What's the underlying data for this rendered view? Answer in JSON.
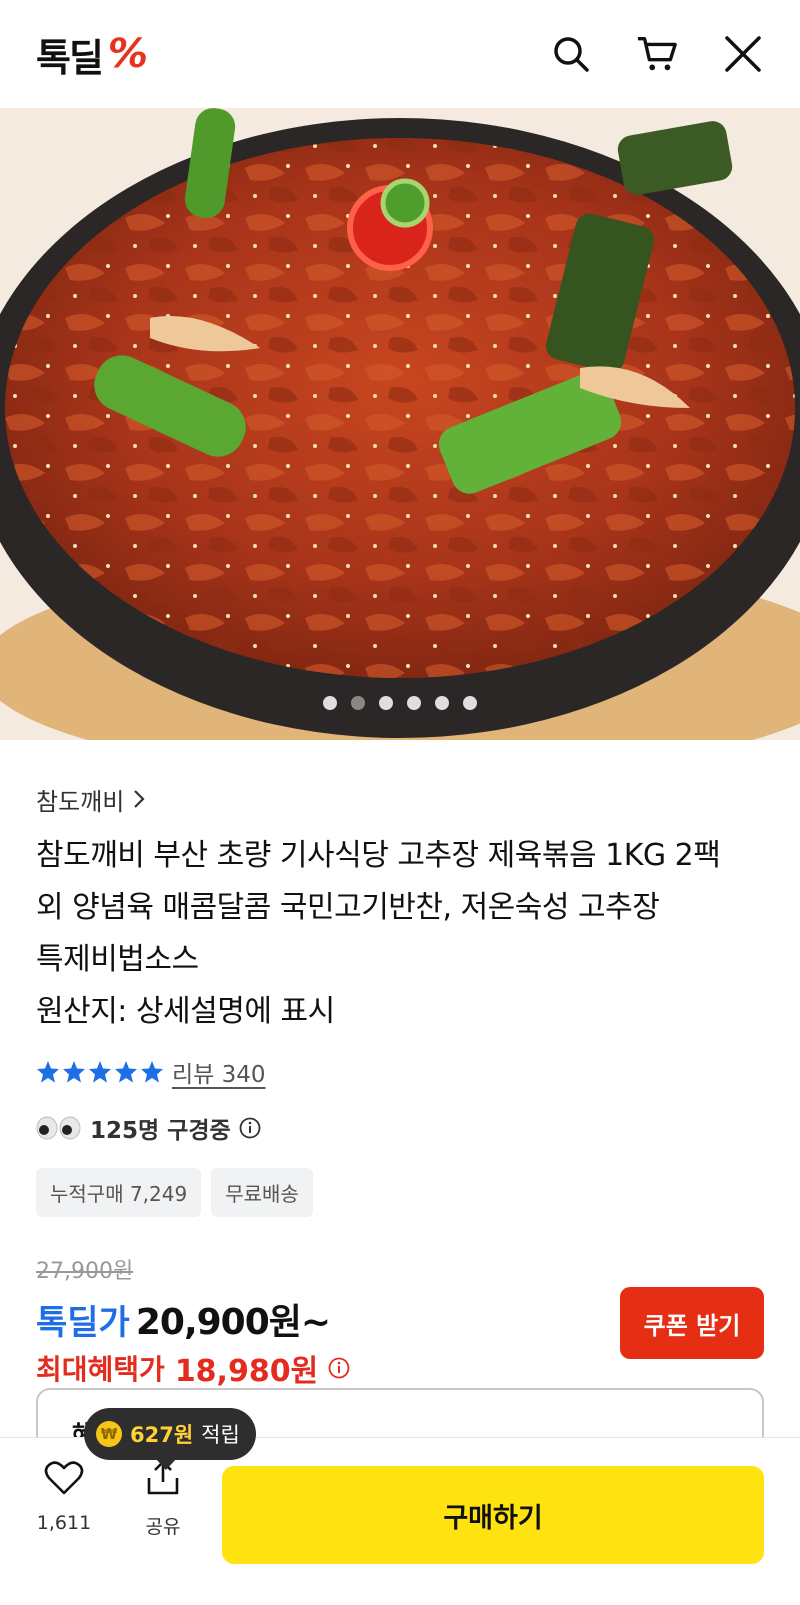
{
  "header": {
    "logo_text": "톡딜",
    "logo_mark": "%",
    "icons": [
      "search-icon",
      "cart-icon",
      "close-icon"
    ]
  },
  "hero": {
    "image_count": 6,
    "active_index": 1
  },
  "product": {
    "seller": "참도깨비",
    "title_lines": [
      "참도깨비 부산 초량 기사식당 고추장 제육볶음 1KG 2팩",
      "외 양념육 매콤달콤 국민고기반찬, 저온숙성 고추장",
      "특제비법소스",
      "원산지: 상세설명에 표시"
    ],
    "rating_stars": 5,
    "review_label": "리뷰 340",
    "watching_text": "125명 구경중",
    "tags": [
      "누적구매 7,249",
      "무료배송"
    ]
  },
  "price": {
    "original": "27,900원",
    "label": "톡딜가",
    "value": "20,900원~",
    "benefit_label": "최대혜택가",
    "benefit_value": "18,980원",
    "coupon_button": "쿠폰 받기"
  },
  "points_tooltip": {
    "amount": "627원",
    "suffix": "적립"
  },
  "info_box_prefix": "혜",
  "bottom": {
    "like_count": "1,611",
    "share_label": "공유",
    "buy_button": "구매하기"
  },
  "colors": {
    "brand_red": "#e8321c",
    "price_blue": "#1e6fe6",
    "benefit_red": "#e32b1e",
    "buy_yellow": "#ffe310",
    "star_blue": "#1e6fe6"
  }
}
